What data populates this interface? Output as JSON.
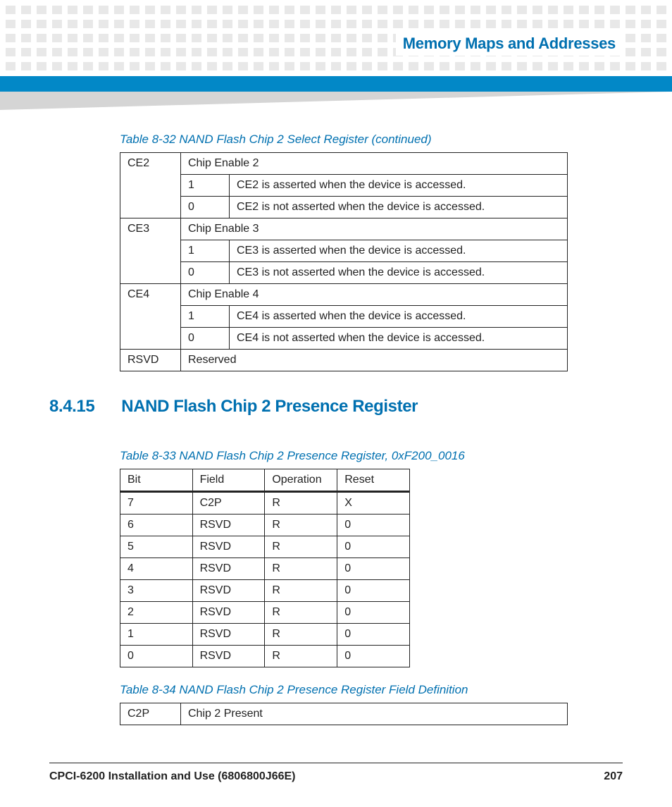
{
  "header": {
    "chapter_title": "Memory Maps and Addresses"
  },
  "table32": {
    "caption": "Table 8-32 NAND Flash Chip 2 Select Register (continued)",
    "rows": [
      {
        "label": "CE2",
        "desc": "Chip Enable 2",
        "sub": [
          {
            "val": "1",
            "txt": "CE2 is asserted when the device is accessed."
          },
          {
            "val": "0",
            "txt": "CE2 is not asserted when the device is accessed."
          }
        ]
      },
      {
        "label": "CE3",
        "desc": "Chip Enable 3",
        "sub": [
          {
            "val": "1",
            "txt": "CE3 is asserted when the device is accessed."
          },
          {
            "val": "0",
            "txt": "CE3 is not asserted when the device is accessed."
          }
        ]
      },
      {
        "label": "CE4",
        "desc": "Chip Enable 4",
        "sub": [
          {
            "val": "1",
            "txt": "CE4 is asserted when the device is accessed."
          },
          {
            "val": "0",
            "txt": "CE4 is not asserted when the device is accessed."
          }
        ]
      },
      {
        "label": "RSVD",
        "desc": "Reserved",
        "sub": []
      }
    ]
  },
  "section": {
    "number": "8.4.15",
    "title": "NAND Flash Chip 2 Presence Register"
  },
  "table33": {
    "caption": "Table 8-33 NAND Flash Chip 2 Presence Register, 0xF200_0016",
    "header": [
      "Bit",
      "Field",
      "Operation",
      "Reset"
    ],
    "rows": [
      [
        "7",
        "C2P",
        "R",
        "X"
      ],
      [
        "6",
        "RSVD",
        "R",
        "0"
      ],
      [
        "5",
        "RSVD",
        "R",
        "0"
      ],
      [
        "4",
        "RSVD",
        "R",
        "0"
      ],
      [
        "3",
        "RSVD",
        "R",
        "0"
      ],
      [
        "2",
        "RSVD",
        "R",
        "0"
      ],
      [
        "1",
        "RSVD",
        "R",
        "0"
      ],
      [
        "0",
        "RSVD",
        "R",
        "0"
      ]
    ]
  },
  "table34": {
    "caption": "Table 8-34 NAND Flash Chip 2 Presence Register Field Definition",
    "rows": [
      [
        "C2P",
        "Chip 2 Present"
      ]
    ]
  },
  "footer": {
    "doc_title": "CPCI-6200 Installation and Use (6806800J66E)",
    "page_number": "207"
  }
}
